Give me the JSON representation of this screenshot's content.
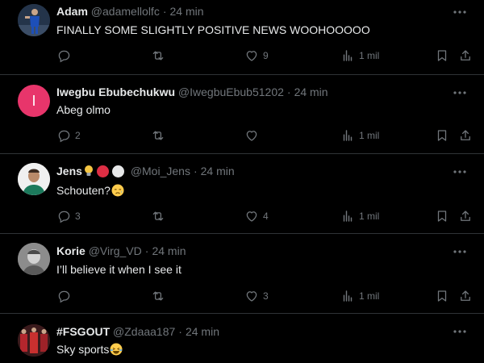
{
  "tweets": [
    {
      "name": "Adam",
      "handle": "@adamellolfc",
      "separator": "·",
      "time": "24 min",
      "text": "FINALLY SOME SLIGHTLY POSITIVE NEWS WOOHOOOOO",
      "replies": "",
      "retweets": "",
      "likes": "9",
      "views": "1 mil",
      "avatar_color": "#2a3b52"
    },
    {
      "name": "Iwegbu Ebubechukwu",
      "handle": "@IwegbuEbub51202",
      "separator": "·",
      "time": "24 min",
      "text": "Abeg olmo",
      "replies": "2",
      "retweets": "",
      "likes": "",
      "views": "1 mil",
      "avatar_letter": "I",
      "avatar_color": "#e8356b"
    },
    {
      "name": "Jens",
      "handle": "@Moi_Jens",
      "separator": "·",
      "time": "24 min",
      "text": "Schouten?",
      "replies": "3",
      "retweets": "",
      "likes": "4",
      "views": "1 mil",
      "avatar_color": "#1c7a5c"
    },
    {
      "name": "Korie",
      "handle": "@Virg_VD",
      "separator": "·",
      "time": "24 min",
      "text": "I’ll believe it when I see it",
      "replies": "",
      "retweets": "",
      "likes": "3",
      "views": "1 mil",
      "avatar_color": "#9a9a9a"
    },
    {
      "name": "#FSGOUT",
      "handle": "@Zdaaa187",
      "separator": "·",
      "time": "24 min",
      "text": "Sky sports",
      "replies": "",
      "retweets": "",
      "likes": "",
      "views": "",
      "avatar_color": "#6b1e22"
    }
  ],
  "icons": {
    "reply": "reply-icon",
    "retweet": "retweet-icon",
    "like": "heart-icon",
    "views": "views-icon",
    "bookmark": "bookmark-icon",
    "share": "share-icon",
    "more": "more-icon"
  },
  "colors": {
    "background": "#000000",
    "text_primary": "#e7e9ea",
    "text_secondary": "#71767b",
    "divider": "#2f3336"
  }
}
